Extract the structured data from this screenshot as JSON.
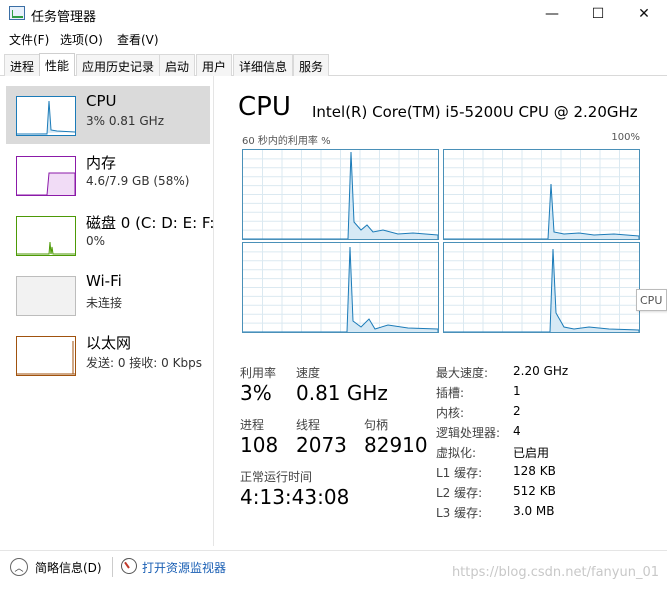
{
  "window": {
    "title": "任务管理器",
    "controls": {
      "minimize": "—",
      "maximize": "☐",
      "close": "✕"
    }
  },
  "menu": [
    "文件(F)",
    "选项(O)",
    "查看(V)"
  ],
  "tabs": [
    {
      "label": "进程",
      "active": false
    },
    {
      "label": "性能",
      "active": true
    },
    {
      "label": "应用历史记录",
      "active": false
    },
    {
      "label": "启动",
      "active": false
    },
    {
      "label": "用户",
      "active": false
    },
    {
      "label": "详细信息",
      "active": false
    },
    {
      "label": "服务",
      "active": false
    }
  ],
  "resources": [
    {
      "name": "CPU",
      "sub": "3% 0.81 GHz",
      "color": "#1b7bb8",
      "selected": true
    },
    {
      "name": "内存",
      "sub": "4.6/7.9 GB (58%)",
      "color": "#8b1aa8",
      "selected": false
    },
    {
      "name": "磁盘 0 (C: D: E: F:",
      "sub": "0%",
      "color": "#4d9a06",
      "selected": false
    },
    {
      "name": "Wi-Fi",
      "sub": "未连接",
      "color": "#bdbdbd",
      "selected": false
    },
    {
      "name": "以太网",
      "sub": "发送: 0 接收: 0 Kbps",
      "color": "#a0520e",
      "selected": false
    }
  ],
  "detail": {
    "header": "CPU",
    "model": "Intel(R) Core(TM) i5-5200U CPU @ 2.20GHz",
    "graph_caption": "60 秒内的利用率 %",
    "graph_max": "100%",
    "hover_tag": "CPU"
  },
  "stats": {
    "utilization": {
      "label": "利用率",
      "value": "3%"
    },
    "speed": {
      "label": "速度",
      "value": "0.81 GHz"
    },
    "processes": {
      "label": "进程",
      "value": "108"
    },
    "threads": {
      "label": "线程",
      "value": "2073"
    },
    "handles": {
      "label": "句柄",
      "value": "82910"
    },
    "uptime": {
      "label": "正常运行时间",
      "value": "4:13:43:08"
    }
  },
  "specs": [
    {
      "key": "最大速度:",
      "value": "2.20 GHz"
    },
    {
      "key": "插槽:",
      "value": "1"
    },
    {
      "key": "内核:",
      "value": "2"
    },
    {
      "key": "逻辑处理器:",
      "value": "4"
    },
    {
      "key": "虚拟化:",
      "value": "已启用"
    },
    {
      "key": "L1 缓存:",
      "value": "128 KB"
    },
    {
      "key": "L2 缓存:",
      "value": "512 KB"
    },
    {
      "key": "L3 缓存:",
      "value": "3.0 MB"
    }
  ],
  "footer": {
    "less_details": "简略信息(D)",
    "open_monitor": "打开资源监视器",
    "watermark": "https://blog.csdn.net/fanyun_01"
  },
  "colors": {
    "cpu_line": "#1b7bb8",
    "cpu_fill": "#d6e9f5",
    "grid": "#dbe9f1"
  }
}
